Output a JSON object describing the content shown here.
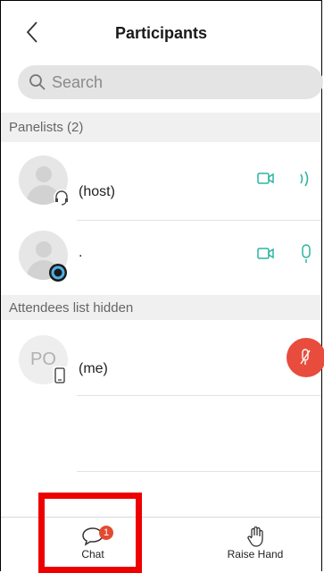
{
  "header": {
    "title": "Participants",
    "back_icon": "chevron-left-icon"
  },
  "search": {
    "placeholder": "Search",
    "icon": "search-icon"
  },
  "panelists": {
    "section_label": "Panelists (2)",
    "items": [
      {
        "name_suffix": "(host)",
        "status_icon": "headset-icon",
        "video_icon": "video-camera-icon",
        "audio_icon": "speaking-icon"
      },
      {
        "name_suffix": ".",
        "status_icon": "status-ring-icon",
        "video_icon": "video-camera-icon",
        "audio_icon": "microphone-icon"
      }
    ]
  },
  "attendees": {
    "section_label": "Attendees list hidden",
    "items": [
      {
        "initials": "PO",
        "name_suffix": "(me)",
        "device_icon": "mobile-phone-icon",
        "audio_icon": "microphone-muted-icon"
      }
    ]
  },
  "bottom_bar": {
    "chat": {
      "label": "Chat",
      "badge": "1",
      "icon": "chat-bubble-icon"
    },
    "raise_hand": {
      "label": "Raise Hand",
      "icon": "hand-icon"
    }
  },
  "colors": {
    "accent": "#2bb5a0",
    "mute_red": "#e84c3d",
    "highlight": "#ee0000"
  }
}
